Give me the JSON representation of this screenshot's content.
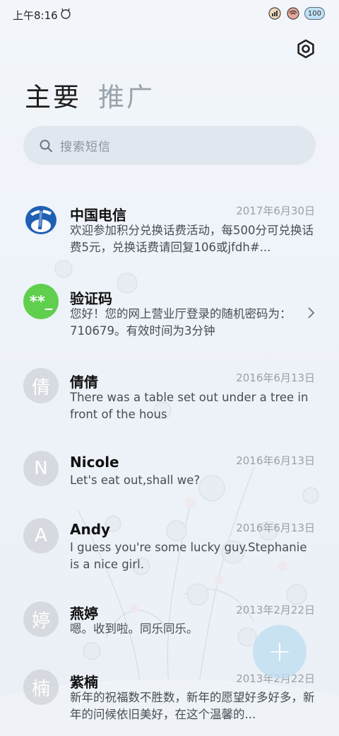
{
  "status_bar": {
    "time": "上午8:16",
    "battery": "100"
  },
  "tabs": [
    {
      "label": "主要",
      "active": true
    },
    {
      "label": "推广",
      "active": false
    }
  ],
  "search": {
    "placeholder": "搜索短信"
  },
  "conversations": [
    {
      "name": "中国电信",
      "date": "2017年6月30日",
      "avatar_type": "logo",
      "avatar_text": "",
      "preview": "欢迎参加积分兑换话费活动，每500分可兑换话费5元，兑换话费请回复106或jfdh#..."
    },
    {
      "name": "验证码",
      "date": "",
      "avatar_type": "green",
      "avatar_text": "**_",
      "preview": "您好！您的网上营业厅登录的随机密码为：710679。有效时间为3分钟",
      "chevron": true
    },
    {
      "name": "倩倩",
      "date": "2016年6月13日",
      "avatar_type": "letter",
      "avatar_text": "倩",
      "preview": "There was a table set out under a tree in front of the hous"
    },
    {
      "name": "Nicole",
      "date": "2016年6月13日",
      "avatar_type": "letter",
      "avatar_text": "N",
      "preview": "Let's eat out,shall we?"
    },
    {
      "name": "Andy",
      "date": "2016年6月13日",
      "avatar_type": "letter",
      "avatar_text": "A",
      "preview": "I guess you're some lucky guy.Stephanie is a nice girl."
    },
    {
      "name": "燕婷",
      "date": "2013年2月22日",
      "avatar_type": "letter",
      "avatar_text": "婷",
      "preview": "嗯。收到啦。同乐同乐。"
    },
    {
      "name": "紫楠",
      "date": "2013年2月22日",
      "avatar_type": "letter",
      "avatar_text": "楠",
      "preview": "新年的祝福数不胜数，新年的愿望好多好多，新年的问候依旧美好，在这个温馨的..."
    }
  ],
  "icons": {
    "settings": "settings-icon",
    "search": "search-icon",
    "fab": "plus-icon"
  },
  "colors": {
    "green_avatar": "#61cf4e",
    "telecom_blue": "#1f5fb4"
  }
}
